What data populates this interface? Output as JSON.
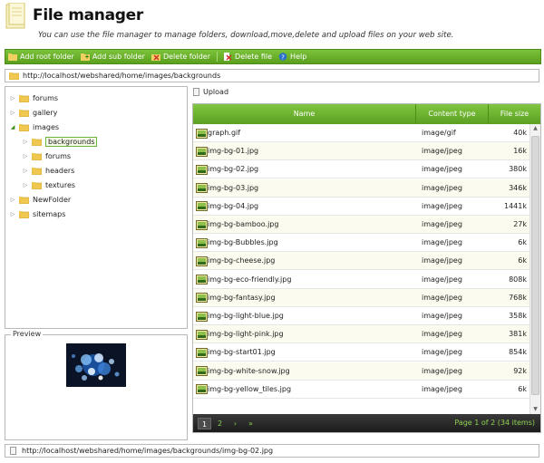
{
  "header": {
    "title": "File manager",
    "subtitle": "You can use the file manager to manage folders, download,move,delete and upload files on your web site."
  },
  "toolbar": {
    "items": [
      {
        "label": "Add root folder",
        "icon": "add-root-folder-icon"
      },
      {
        "label": "Add sub folder",
        "icon": "add-sub-folder-icon"
      },
      {
        "label": "Delete folder",
        "icon": "delete-folder-icon"
      },
      {
        "label": "Delete file",
        "icon": "delete-file-icon"
      },
      {
        "label": "Help",
        "icon": "help-icon"
      }
    ]
  },
  "path": "http://localhost/webshared/home/images/backgrounds",
  "tree": {
    "items": [
      {
        "label": "forums",
        "level": 0,
        "expanded": false
      },
      {
        "label": "gallery",
        "level": 0,
        "expanded": false
      },
      {
        "label": "images",
        "level": 0,
        "expanded": true
      },
      {
        "label": "backgrounds",
        "level": 1,
        "expanded": false,
        "selected": true
      },
      {
        "label": "forums",
        "level": 1,
        "expanded": false
      },
      {
        "label": "headers",
        "level": 1,
        "expanded": false
      },
      {
        "label": "textures",
        "level": 1,
        "expanded": false
      },
      {
        "label": "NewFolder",
        "level": 0,
        "expanded": false
      },
      {
        "label": "sitemaps",
        "level": 0,
        "expanded": false
      }
    ]
  },
  "preview": {
    "label": "Preview"
  },
  "upload": {
    "label": "Upload"
  },
  "grid": {
    "columns": [
      "Name",
      "Content type",
      "File size"
    ],
    "rows": [
      {
        "name": "graph.gif",
        "type": "image/gif",
        "size": "40k"
      },
      {
        "name": "img-bg-01.jpg",
        "type": "image/jpeg",
        "size": "16k"
      },
      {
        "name": "img-bg-02.jpg",
        "type": "image/jpeg",
        "size": "380k"
      },
      {
        "name": "img-bg-03.jpg",
        "type": "image/jpeg",
        "size": "346k"
      },
      {
        "name": "img-bg-04.jpg",
        "type": "image/jpeg",
        "size": "1441k"
      },
      {
        "name": "img-bg-bamboo.jpg",
        "type": "image/jpeg",
        "size": "27k"
      },
      {
        "name": "img-bg-Bubbles.jpg",
        "type": "image/jpeg",
        "size": "6k"
      },
      {
        "name": "img-bg-cheese.jpg",
        "type": "image/jpeg",
        "size": "6k"
      },
      {
        "name": "img-bg-eco-friendly.jpg",
        "type": "image/jpeg",
        "size": "808k"
      },
      {
        "name": "img-bg-fantasy.jpg",
        "type": "image/jpeg",
        "size": "768k"
      },
      {
        "name": "img-bg-light-blue.jpg",
        "type": "image/jpeg",
        "size": "358k"
      },
      {
        "name": "img-bg-light-pink.jpg",
        "type": "image/jpeg",
        "size": "381k"
      },
      {
        "name": "img-bg-start01.jpg",
        "type": "image/jpeg",
        "size": "854k"
      },
      {
        "name": "img-bg-white-snow.jpg",
        "type": "image/jpeg",
        "size": "92k"
      },
      {
        "name": "img-bg-yellow_tiles.jpg",
        "type": "image/jpeg",
        "size": "6k"
      }
    ]
  },
  "pager": {
    "pages": [
      "1",
      "2"
    ],
    "current_page": "1",
    "next": "›",
    "last": "»",
    "info": "Page 1 of 2 (34 items)"
  },
  "status": "http://localhost/webshared/home/images/backgrounds/img-bg-02.jpg",
  "colors": {
    "accent": "#6cb43a",
    "pager_bg": "#222222",
    "pager_text": "#8fd14f"
  }
}
